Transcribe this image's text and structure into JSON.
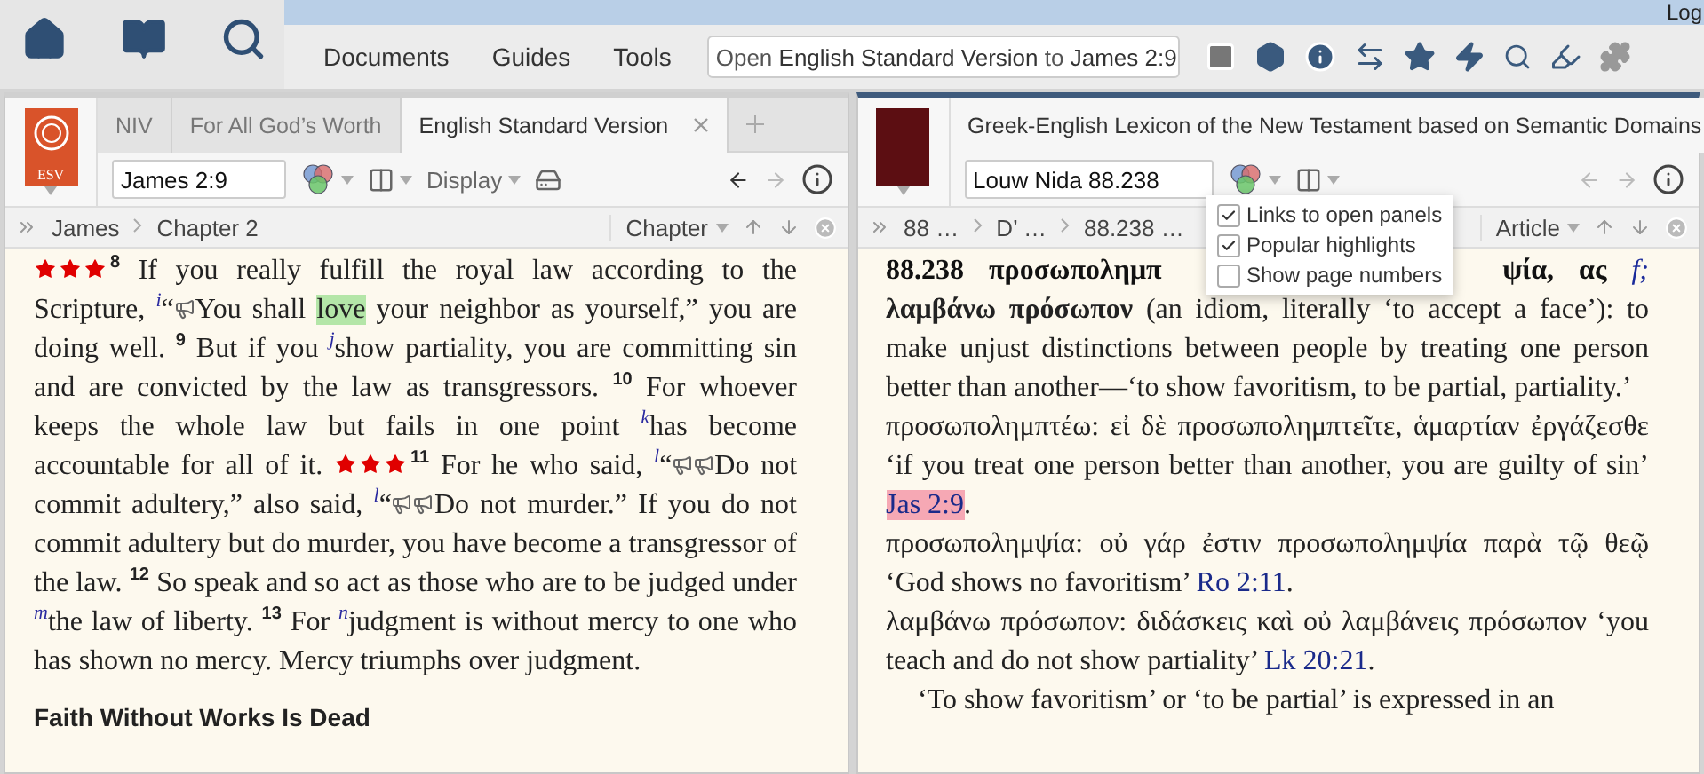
{
  "top_strip": {
    "text": "Log"
  },
  "menu": [
    {
      "label": "Documents"
    },
    {
      "label": "Guides"
    },
    {
      "label": "Tools"
    }
  ],
  "command_box": {
    "value": "Open **English Standard Version** to **James 2:9**"
  },
  "panels": [
    {
      "active": false,
      "cover": {
        "kind": "logo",
        "label": "ESV"
      },
      "tabs": [
        {
          "label": "NIV",
          "selected": false
        },
        {
          "label": "For All God’s Worth",
          "selected": false
        },
        {
          "label": "English Standard Version",
          "selected": true
        }
      ],
      "reference": "James 2:9",
      "display_label": "Display",
      "nav": {
        "back_enabled": true,
        "forward_enabled": false
      },
      "breadcrumb": [
        "James",
        "Chapter 2"
      ],
      "scope": "Chapter",
      "blocks": [
        {
          "kind": "paragraph",
          "indent": false,
          "segments": [
            {
              "kind": "stars",
              "stars": 3
            },
            {
              "kind": "verse",
              "text": "8"
            },
            {
              "kind": "text",
              "text": " If you really fulfill the royal law according to the Scripture, "
            },
            {
              "kind": "note",
              "text": "i"
            },
            {
              "kind": "text",
              "text": "“"
            },
            {
              "kind": "audio"
            },
            {
              "kind": "text",
              "text": "You shall "
            },
            {
              "kind": "highlight",
              "text": "love",
              "color": "#b4e6a8"
            },
            {
              "kind": "text",
              "text": " your neighbor as yourself,” you are doing well. "
            },
            {
              "kind": "verse",
              "text": "9"
            },
            {
              "kind": "text",
              "text": " But if you "
            },
            {
              "kind": "note",
              "text": "j"
            },
            {
              "kind": "text",
              "text": "show partiality, you are committing sin and are convicted by the law as transgressors. "
            },
            {
              "kind": "verse",
              "text": "10"
            },
            {
              "kind": "text",
              "text": " For whoever keeps the whole law but fails in one point "
            },
            {
              "kind": "note",
              "text": "k"
            },
            {
              "kind": "text",
              "text": "has become accountable for all of it. "
            },
            {
              "kind": "stars",
              "stars": 3
            },
            {
              "kind": "verse",
              "text": "11"
            },
            {
              "kind": "text",
              "text": " For he who said, "
            },
            {
              "kind": "note",
              "text": "l"
            },
            {
              "kind": "text",
              "text": "“"
            },
            {
              "kind": "audio"
            },
            {
              "kind": "audio"
            },
            {
              "kind": "text",
              "text": "Do not commit adultery,” also said, "
            },
            {
              "kind": "note",
              "text": "l"
            },
            {
              "kind": "text",
              "text": "“"
            },
            {
              "kind": "audio"
            },
            {
              "kind": "audio"
            },
            {
              "kind": "text",
              "text": "Do not murder.” If you do not commit adultery but do murder, you have become a transgressor of the law. "
            },
            {
              "kind": "verse",
              "text": "12"
            },
            {
              "kind": "text",
              "text": " So speak and so act as those who are to be judged under "
            },
            {
              "kind": "note",
              "text": "m"
            },
            {
              "kind": "text",
              "text": "the law of liberty. "
            },
            {
              "kind": "verse",
              "text": "13"
            },
            {
              "kind": "text",
              "text": " For "
            },
            {
              "kind": "note",
              "text": "n"
            },
            {
              "kind": "text",
              "text": "judgment is without mercy to one who has shown no mercy. Mercy triumphs over judgment."
            }
          ]
        },
        {
          "kind": "heading",
          "text": "Faith Without Works Is Dead"
        }
      ]
    },
    {
      "active": true,
      "cover": {
        "kind": "plain"
      },
      "tabs": [
        {
          "label": "Greek-English Lexicon of the New Testament based on Semantic Domains",
          "selected": true
        }
      ],
      "reference": "Louw Nida 88.238",
      "nav": {
        "back_enabled": false,
        "forward_enabled": false
      },
      "breadcrumb": [
        "88 …",
        "D’ …",
        "88.238 …"
      ],
      "scope": "Article",
      "popup": {
        "items": [
          {
            "label": "Links to open panels",
            "checked": true
          },
          {
            "label": "Popular highlights",
            "checked": true
          },
          {
            "label": "Show page numbers",
            "checked": false
          }
        ]
      },
      "blocks": [
        {
          "kind": "headline",
          "words": [
            {
              "kind": "bold",
              "text": "88.238"
            },
            {
              "kind": "bold",
              "text": "προσωπολημπ"
            },
            {
              "kind": "bold",
              "text": "ψία,"
            },
            {
              "kind": "bold",
              "text": "ας"
            },
            {
              "kind": "note",
              "text": "f;"
            }
          ]
        },
        {
          "kind": "paragraph",
          "indent": false,
          "segments": [
            {
              "kind": "bold",
              "text": "λαμβάνω πρόσωπον"
            },
            {
              "kind": "text",
              "text": " (an idiom, literally ‘to accept a face’): to make unjust distinctions between people by treating one person better than another—‘to show favoritism, to be partial, partiality.’"
            }
          ]
        },
        {
          "kind": "paragraph",
          "indent": false,
          "segments": [
            {
              "kind": "text",
              "text": "προσωπολημπτέω: εἰ δὲ προσωπολημπτεῖτε, ἁμαρτίαν ἐργάζεσθε ‘if you treat one person better than another, you are guilty of sin’ "
            },
            {
              "kind": "link",
              "text": "Jas 2:9",
              "highlighted": true
            },
            {
              "kind": "text",
              "text": "."
            }
          ]
        },
        {
          "kind": "paragraph",
          "indent": false,
          "segments": [
            {
              "kind": "text",
              "text": "προσωπολημψία: οὐ γάρ ἐστιν προσωπολημψία παρὰ τῷ θεῷ ‘God shows no favoritism’ "
            },
            {
              "kind": "link",
              "text": "Ro 2:11",
              "highlighted": false
            },
            {
              "kind": "text",
              "text": "."
            }
          ]
        },
        {
          "kind": "paragraph",
          "indent": false,
          "segments": [
            {
              "kind": "text",
              "text": "λαμβάνω πρόσωπον: διδάσκεις καὶ οὐ λαμβάνεις πρόσωπον ‘you teach and do not show partiality’ "
            },
            {
              "kind": "link",
              "text": "Lk 20:21",
              "highlighted": false
            },
            {
              "kind": "text",
              "text": "."
            }
          ]
        },
        {
          "kind": "paragraph",
          "indent": true,
          "segments": [
            {
              "kind": "text",
              "text": "‘To show favoritism’ or ‘to be partial’ is expressed in an"
            }
          ]
        }
      ]
    }
  ]
}
